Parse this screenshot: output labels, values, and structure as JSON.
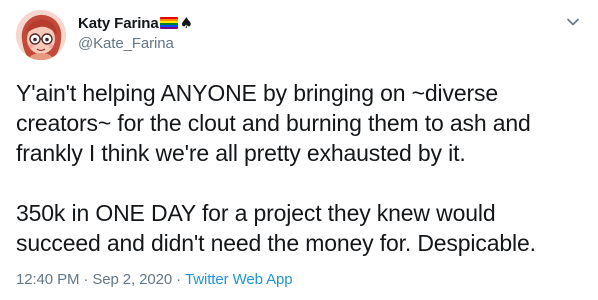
{
  "user": {
    "display_name": "Katy Farina",
    "handle": "@Kate_Farina",
    "flag_colors": [
      "#e40303",
      "#ff8c00",
      "#ffed00",
      "#008026",
      "#004dff",
      "#750787"
    ],
    "suffix_icon": "spade-icon"
  },
  "tweet": {
    "paragraph_1": "Y'ain't helping ANYONE by bringing on ~diverse creators~ for the clout and burning them to ash and frankly I think we're all pretty exhausted by it.",
    "paragraph_2": "350k in ONE DAY for a project they knew would succeed and didn't need the money for. Despicable."
  },
  "meta": {
    "time": "12:40 PM",
    "separator": "·",
    "date": "Sep 2, 2020",
    "source": "Twitter Web App"
  },
  "colors": {
    "text": "#14171a",
    "secondary": "#657786",
    "link": "#1b95e0"
  },
  "icons": {
    "menu": "chevron-down-icon",
    "avatar": "avatar"
  }
}
